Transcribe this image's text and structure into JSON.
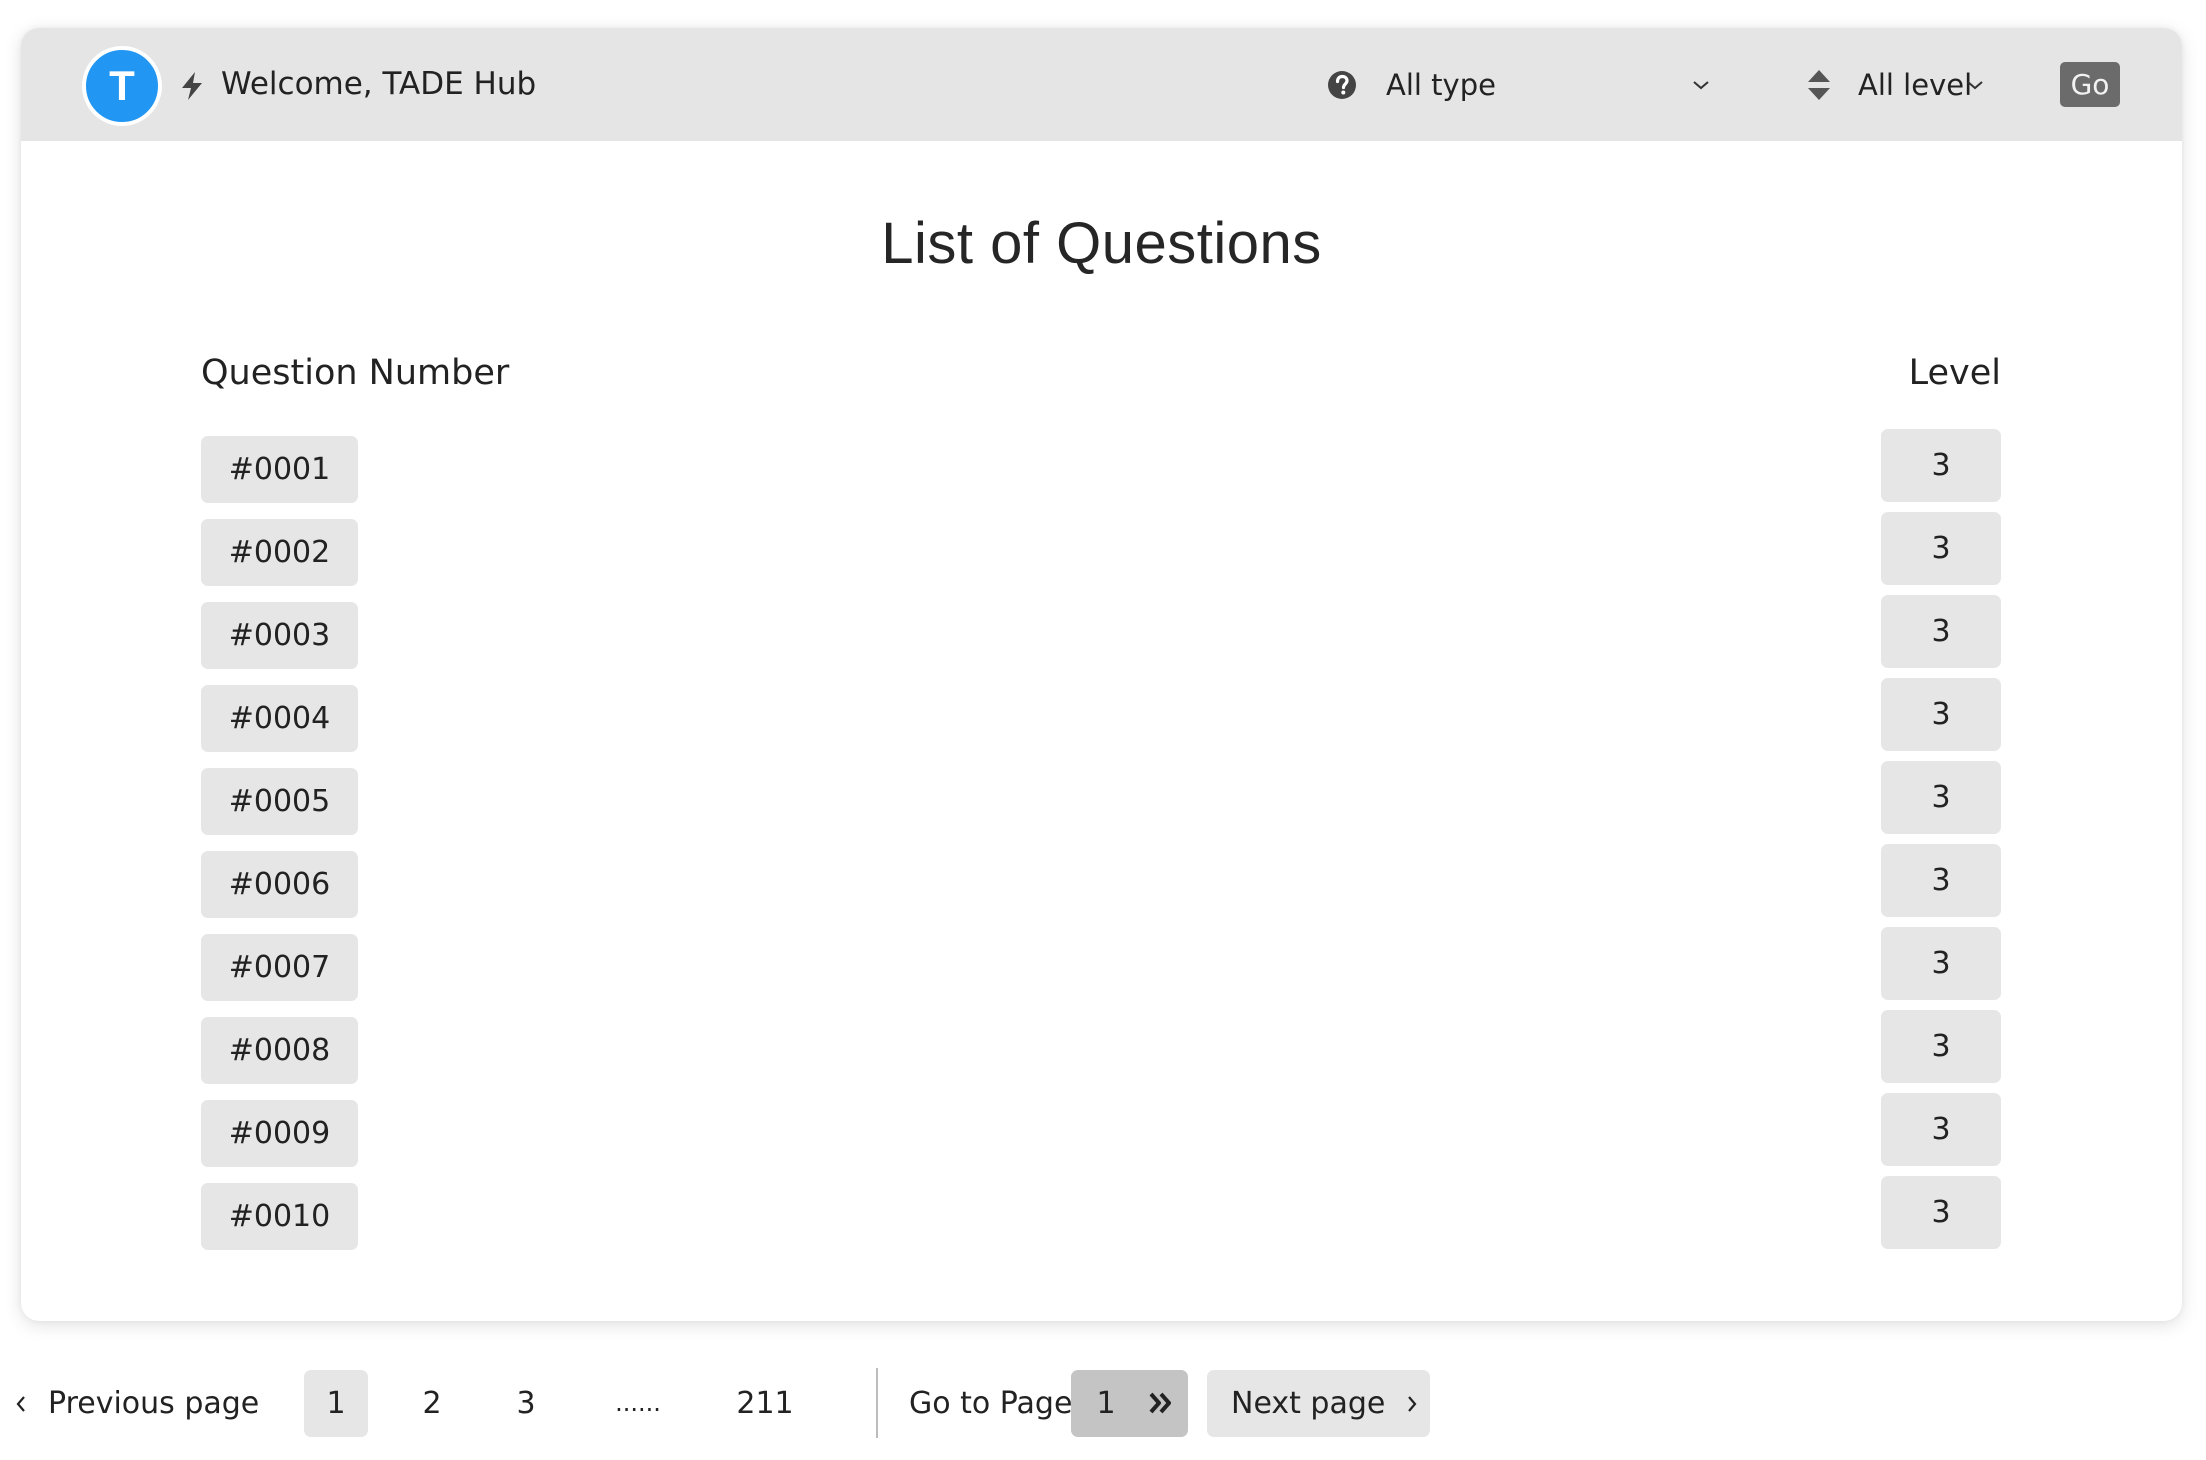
{
  "header": {
    "avatar_initial": "T",
    "welcome_text": "Welcome, TADE Hub",
    "type_filter": {
      "selected": "All type",
      "icon": "question-circle-icon"
    },
    "level_filter": {
      "selected": "All level",
      "icon": "sort-icon"
    },
    "go_label": "Go"
  },
  "colors": {
    "avatar": "#2196f3",
    "header_bg": "#e5e5e5",
    "button_bg": "#e6e6e6",
    "go_bg": "#6b6b6b",
    "goto_bg": "#c4c4c4"
  },
  "main": {
    "title": "List of Questions",
    "columns": {
      "question_number": "Question Number",
      "level": "Level"
    },
    "rows": [
      {
        "number": "#0001",
        "level": "3"
      },
      {
        "number": "#0002",
        "level": "3"
      },
      {
        "number": "#0003",
        "level": "3"
      },
      {
        "number": "#0004",
        "level": "3"
      },
      {
        "number": "#0005",
        "level": "3"
      },
      {
        "number": "#0006",
        "level": "3"
      },
      {
        "number": "#0007",
        "level": "3"
      },
      {
        "number": "#0008",
        "level": "3"
      },
      {
        "number": "#0009",
        "level": "3"
      },
      {
        "number": "#0010",
        "level": "3"
      }
    ]
  },
  "pagination": {
    "previous_label": "Previous page",
    "pages": [
      "1",
      "2",
      "3",
      "......",
      "211"
    ],
    "current_page": "1",
    "goto_label": "Go to Page",
    "goto_value": "1",
    "next_label": "Next page"
  }
}
